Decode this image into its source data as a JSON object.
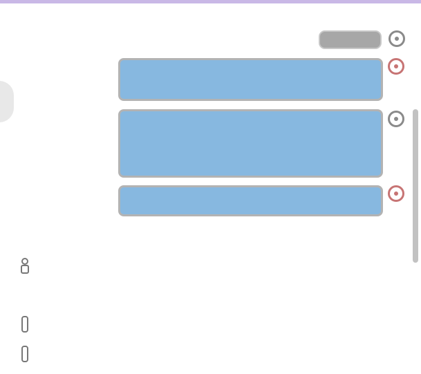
{
  "header": {
    "title": ""
  },
  "tag_message": {
    "text": ""
  },
  "messages": [
    {
      "lines": [
        "",
        "",
        ""
      ]
    },
    {
      "lines": [
        "",
        "",
        "",
        "",
        ""
      ]
    },
    {
      "lines": [
        "",
        ""
      ]
    }
  ],
  "sections": [
    {
      "label": "",
      "items": [
        {
          "label": ""
        }
      ]
    },
    {
      "label": "",
      "items": [
        {
          "label": ""
        },
        {
          "label": ""
        }
      ]
    }
  ]
}
